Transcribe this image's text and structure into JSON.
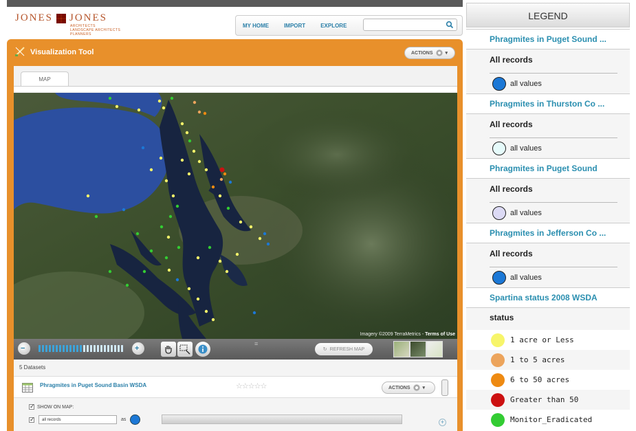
{
  "brand": {
    "name_left": "JONES",
    "name_right": "JONES",
    "subtitle": [
      "ARCHITECTS",
      "LANDSCAPE ARCHITECTS",
      "PLANNERS"
    ]
  },
  "nav": {
    "items": [
      "MY HOME",
      "IMPORT",
      "EXPLORE"
    ],
    "search_value": "",
    "search_icon": "search-icon"
  },
  "tool": {
    "title": "Visualization Tool",
    "actions_label": "ACTIONS"
  },
  "tabs": {
    "map": "MAP"
  },
  "map": {
    "credit_prefix": "Imagery ©2009 TerraMetrics",
    "credit_link": "Terms of Use",
    "zoom_level_fraction": 0.52,
    "refresh_label": "REFRESH MAP"
  },
  "datasets": {
    "count_label": "5 Datasets",
    "first": {
      "name": "Phragmites in Puget Sound Basin WSDA",
      "rating": "☆☆☆☆☆",
      "actions_label": "ACTIONS",
      "show_on_map_label": "SHOW ON MAP:",
      "records_value": "all records",
      "as_label": "as",
      "add_label": "+"
    }
  },
  "legend": {
    "title": "LEGEND",
    "groups": [
      {
        "name": "Phragmites in Puget Sound ...",
        "sub": "All records",
        "item": "all values",
        "color": "#1c78d6"
      },
      {
        "name": "Phragmites in Thurston Co ...",
        "sub": "All records",
        "item": "all values",
        "color": "#e6fbfb"
      },
      {
        "name": "Phragmites in Puget Sound",
        "sub": "All records",
        "item": "all values",
        "color": "#dcdaf5"
      },
      {
        "name": "Phragmites in Jefferson Co ...",
        "sub": "All records",
        "item": "all values",
        "color": "#1c78d6"
      }
    ],
    "status_group": {
      "name": "Spartina status 2008 WSDA",
      "sub": "status",
      "items": [
        {
          "label": "1 acre or Less",
          "color": "#f7f56a"
        },
        {
          "label": "1 to 5 acres",
          "color": "#eca45c"
        },
        {
          "label": "6 to 50 acres",
          "color": "#ee8a12"
        },
        {
          "label": "Greater than 50",
          "color": "#cc1111"
        },
        {
          "label": "Monitor_Eradicated",
          "color": "#33cc33"
        }
      ]
    }
  }
}
